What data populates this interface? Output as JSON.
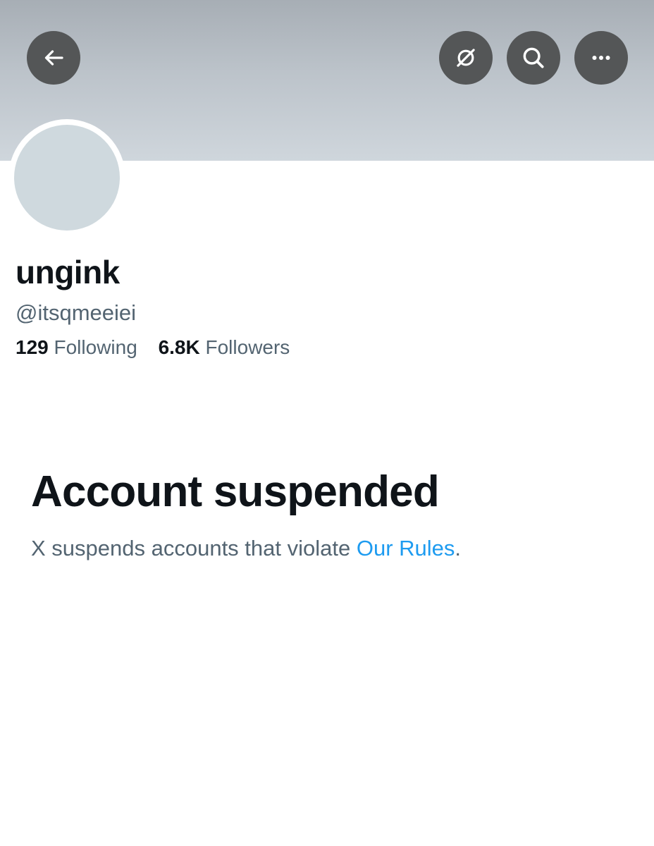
{
  "header": {
    "back_icon": "arrow-left-icon",
    "grok_icon": "slashed-circle-icon",
    "search_icon": "search-icon",
    "more_icon": "more-dots-icon"
  },
  "profile": {
    "display_name": "ungink",
    "handle": "@itsqmeeiei",
    "following_count": "129",
    "following_label": "Following",
    "followers_count": "6.8K",
    "followers_label": "Followers"
  },
  "suspension": {
    "title": "Account suspended",
    "message_prefix": "X suspends accounts that violate ",
    "rules_link": "Our Rules",
    "message_suffix": "."
  },
  "colors": {
    "button_bg": "#545657",
    "link": "#1d9bf0",
    "secondary_text": "#536471",
    "primary_text": "#0f1419",
    "avatar_placeholder": "#cfd9de"
  }
}
